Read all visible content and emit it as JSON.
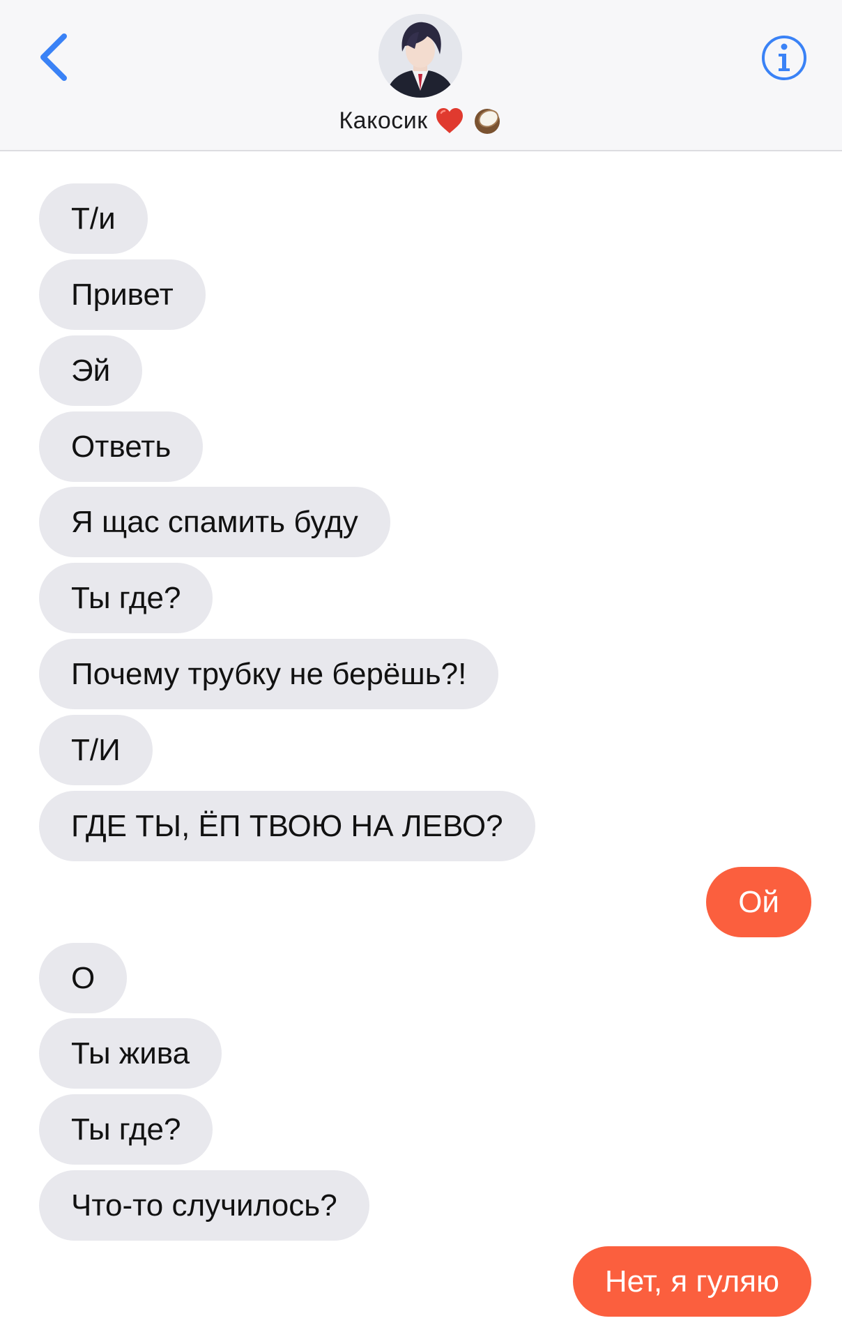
{
  "header": {
    "contact_name": "Какосик",
    "emoji": [
      "heart",
      "coconut"
    ]
  },
  "icons": {
    "back": "chevron-left-icon",
    "info": "info-circle-icon"
  },
  "colors": {
    "accent_blue": "#3a82f6",
    "outgoing_bubble": "#fb5f3e",
    "incoming_bubble": "#e8e8ed"
  },
  "messages": [
    {
      "side": "incoming",
      "text": "Т/и"
    },
    {
      "side": "incoming",
      "text": "Привет"
    },
    {
      "side": "incoming",
      "text": "Эй"
    },
    {
      "side": "incoming",
      "text": "Ответь"
    },
    {
      "side": "incoming",
      "text": "Я щас спамить буду"
    },
    {
      "side": "incoming",
      "text": "Ты где?"
    },
    {
      "side": "incoming",
      "text": "Почему трубку не берёшь?!"
    },
    {
      "side": "incoming",
      "text": "Т/И"
    },
    {
      "side": "incoming",
      "text": "ГДЕ ТЫ, ЁП ТВОЮ НА ЛЕВО?"
    },
    {
      "side": "outgoing",
      "text": "Ой"
    },
    {
      "side": "incoming",
      "text": "О"
    },
    {
      "side": "incoming",
      "text": "Ты жива"
    },
    {
      "side": "incoming",
      "text": "Ты где?"
    },
    {
      "side": "incoming",
      "text": "Что-то случилось?"
    },
    {
      "side": "outgoing",
      "text": "Нет, я гуляю"
    }
  ]
}
